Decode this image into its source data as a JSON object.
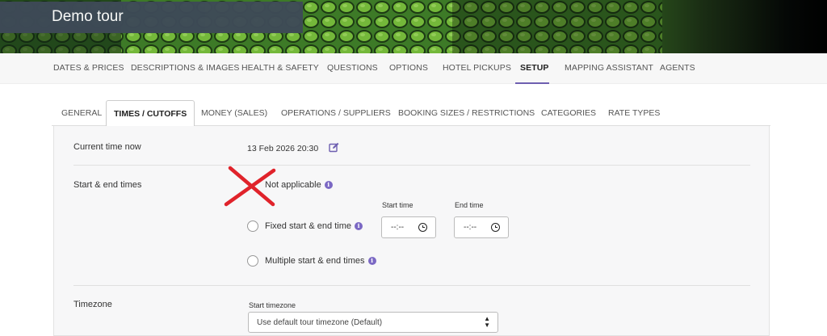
{
  "banner": {
    "title": "Demo tour"
  },
  "main_nav": {
    "items": [
      {
        "label": "DATES & PRICES",
        "active": false
      },
      {
        "label": "DESCRIPTIONS & IMAGES",
        "active": false
      },
      {
        "label": "HEALTH & SAFETY",
        "active": false
      },
      {
        "label": "QUESTIONS",
        "active": false
      },
      {
        "label": "OPTIONS",
        "active": false
      },
      {
        "label": "HOTEL PICKUPS",
        "active": false
      },
      {
        "label": "SETUP",
        "active": true
      },
      {
        "label": "MAPPING ASSISTANT",
        "active": false
      },
      {
        "label": "AGENTS",
        "active": false
      }
    ]
  },
  "sub_tabs": {
    "items": [
      {
        "label": "GENERAL",
        "active": false
      },
      {
        "label": "TIMES / CUTOFFS",
        "active": true
      },
      {
        "label": "MONEY (SALES)",
        "active": false
      },
      {
        "label": "OPERATIONS / SUPPLIERS",
        "active": false
      },
      {
        "label": "BOOKING SIZES / RESTRICTIONS",
        "active": false
      },
      {
        "label": "CATEGORIES",
        "active": false
      },
      {
        "label": "RATE TYPES",
        "active": false
      }
    ]
  },
  "current_time": {
    "label": "Current time now",
    "value": "13 Feb 2026 20:30",
    "edit_icon": "edit-icon"
  },
  "start_end": {
    "label": "Start & end times",
    "options": [
      {
        "label": "Not applicable",
        "info": "i"
      },
      {
        "label": "Fixed start & end time",
        "info": "i"
      },
      {
        "label": "Multiple start & end times",
        "info": "i"
      }
    ],
    "start_time_label": "Start time",
    "end_time_label": "End time",
    "start_time_placeholder": "--:--",
    "end_time_placeholder": "--:--",
    "annotation": "red-x-mark",
    "annotation_color": "#e0232b"
  },
  "timezone": {
    "label": "Timezone",
    "field_label": "Start timezone",
    "selected": "Use default tour timezone (Default)"
  },
  "colors": {
    "accent": "#6e5fb0",
    "info": "#7b68c4",
    "banner_title_bg": "#3e4a57"
  }
}
